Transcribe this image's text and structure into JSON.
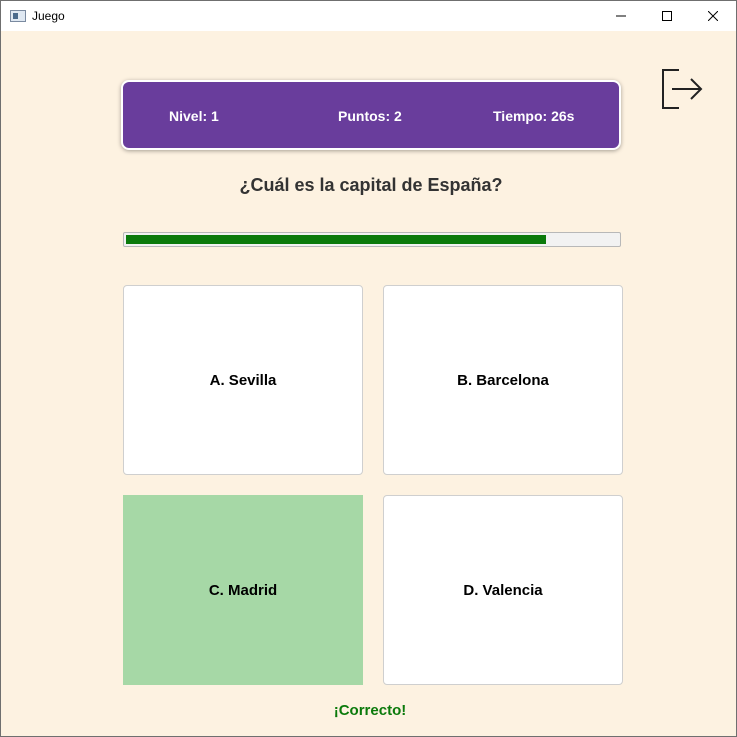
{
  "window": {
    "title": "Juego",
    "app_icon": "window-app-icon",
    "controls": [
      "minimize-icon",
      "maximize-icon",
      "close-icon"
    ]
  },
  "exit_icon": "exit-icon",
  "status": {
    "level": "Nivel: 1",
    "points": "Puntos: 2",
    "time": "Tiempo: 26s"
  },
  "question": "¿Cuál es la capital de España?",
  "progress": {
    "fraction": 0.85
  },
  "answers": [
    {
      "label": "A. Sevilla",
      "state": "default"
    },
    {
      "label": "B. Barcelona",
      "state": "default"
    },
    {
      "label": "C. Madrid",
      "state": "correct"
    },
    {
      "label": "D. Valencia",
      "state": "default"
    }
  ],
  "feedback": "¡Correcto!",
  "colors": {
    "background": "#fdf2e1",
    "status_bar": "#693d9c",
    "progress_fill": "#0b7a0b",
    "correct_answer": "#a6d8a6",
    "feedback_text": "#0b7a0b"
  }
}
